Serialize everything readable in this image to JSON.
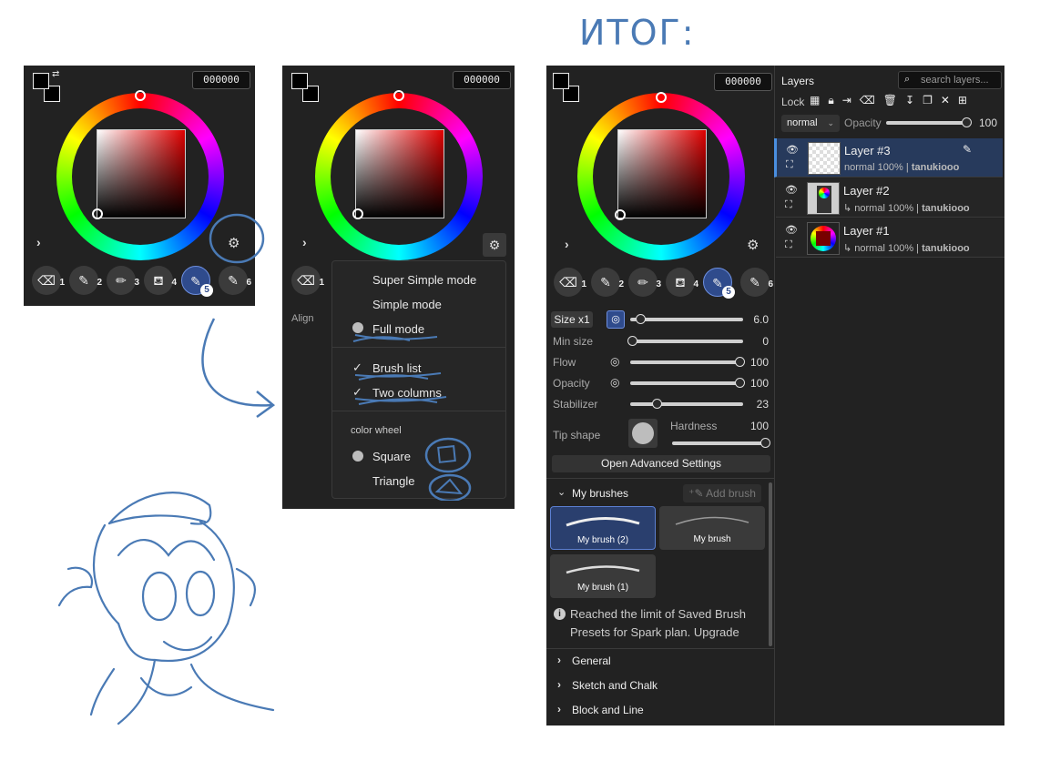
{
  "heading": "ИТОГ:",
  "color_hex": "000000",
  "panel_a": {
    "tools": [
      "1",
      "2",
      "3",
      "4",
      "5",
      "6"
    ]
  },
  "panel_b": {
    "align_label": "Align",
    "menu": {
      "super_simple": "Super Simple mode",
      "simple": "Simple mode",
      "full": "Full mode",
      "brush_list": "Brush list",
      "two_columns": "Two columns",
      "section": "color wheel",
      "square": "Square",
      "triangle": "Triangle"
    }
  },
  "panel_c": {
    "size_label": "Size x1",
    "rows": [
      {
        "label": "Min size",
        "value": "0",
        "fill": 0
      },
      {
        "label": "Flow",
        "value": "100",
        "fill": 1.0
      },
      {
        "label": "Opacity",
        "value": "100",
        "fill": 1.0
      },
      {
        "label": "Stabilizer",
        "value": "23",
        "fill": 0.23
      }
    ],
    "size_value": "6.0",
    "tip_shape": "Tip shape",
    "hardness_label": "Hardness",
    "hardness_value": "100",
    "advanced": "Open Advanced Settings",
    "my_brushes": "My brushes",
    "add_brush": "Add brush",
    "brushes": [
      "My brush (2)",
      "My brush",
      "My brush (1)"
    ],
    "limit_line1": "Reached the limit of Saved Brush",
    "limit_line2": "Presets for Spark plan. Upgrade",
    "categories": [
      "General",
      "Sketch and Chalk",
      "Block and Line"
    ]
  },
  "layers": {
    "title": "Layers",
    "search_placeholder": "search layers...",
    "lock_label": "Lock",
    "blend_mode": "normal",
    "opacity_label": "Opacity",
    "opacity_value": "100",
    "items": [
      {
        "name": "Layer #3",
        "mode": "normal 100%",
        "owner": "tanukiooo"
      },
      {
        "name": "Layer #2",
        "mode": "normal 100%",
        "owner": "tanukiooo"
      },
      {
        "name": "Layer #1",
        "mode": "normal 100%",
        "owner": "tanukiooo"
      }
    ]
  },
  "colors": {
    "ink": "#4a7ab5",
    "accent": "#2f4b8c",
    "panel": "#222222"
  }
}
